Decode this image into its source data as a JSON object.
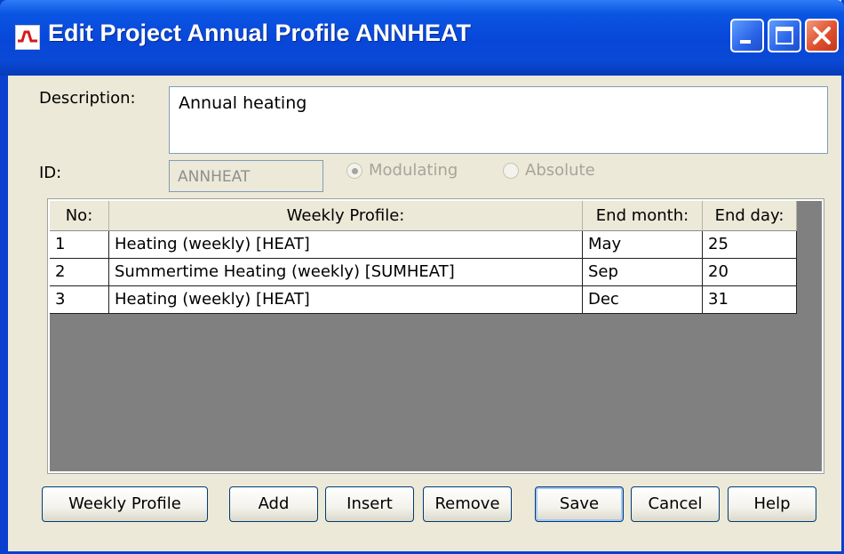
{
  "window": {
    "title": "Edit Project Annual Profile ANNHEAT",
    "controls": [
      "minimize-icon",
      "maximize-icon",
      "close-icon"
    ],
    "accent": "#0a55e3"
  },
  "form": {
    "description_label": "Description:",
    "description_value": "Annual heating",
    "id_label": "ID:",
    "id_value": "ANNHEAT",
    "radio_modulating": "Modulating",
    "radio_absolute": "Absolute",
    "selected_mode": "Modulating"
  },
  "table": {
    "headers": [
      "No:",
      "Weekly Profile:",
      "End month:",
      "End day:"
    ],
    "rows": [
      {
        "no": "1",
        "profile": "Heating (weekly) [HEAT]",
        "month": "May",
        "day": "25"
      },
      {
        "no": "2",
        "profile": "Summertime Heating (weekly) [SUMHEAT]",
        "month": "Sep",
        "day": "20"
      },
      {
        "no": "3",
        "profile": "Heating (weekly) [HEAT]",
        "month": "Dec",
        "day": "31"
      }
    ]
  },
  "buttons": {
    "weekly_profile": "Weekly Profile",
    "add": "Add",
    "insert": "Insert",
    "remove": "Remove",
    "save": "Save",
    "cancel": "Cancel",
    "help": "Help"
  }
}
